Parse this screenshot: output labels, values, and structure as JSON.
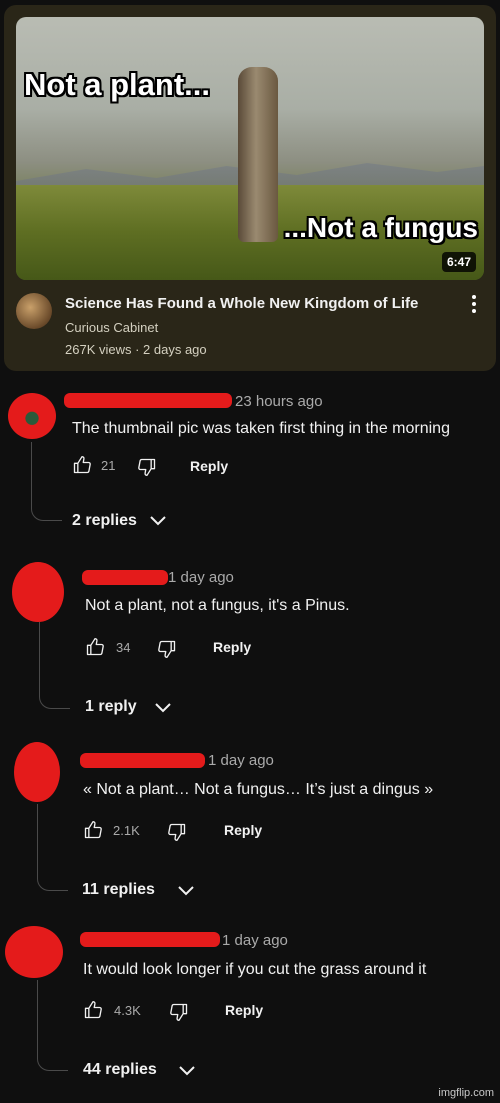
{
  "video": {
    "thumb_text_top": "Not a plant...",
    "thumb_text_bottom": "...Not a fungus",
    "duration": "6:47",
    "title": "Science Has Found a Whole New Kingdom of Life",
    "channel": "Curious Cabinet",
    "meta": "267K views · 2 days ago"
  },
  "comments": [
    {
      "time": "23 hours ago",
      "text": "The thumbnail  pic was taken first thing in the morning",
      "likes": "21",
      "reply": "Reply",
      "replies": "2 replies"
    },
    {
      "time": "1 day ago",
      "text": "Not a plant, not a fungus, it's a Pinus.",
      "likes": "34",
      "reply": "Reply",
      "replies": "1 reply"
    },
    {
      "time": "1 day ago",
      "text": "« Not a plant… Not a fungus… It’s just a dingus »",
      "likes": "2.1K",
      "reply": "Reply",
      "replies": "11 replies"
    },
    {
      "time": "1 day ago",
      "text": "It would look longer if you cut the grass around it",
      "likes": "4.3K",
      "reply": "Reply",
      "replies": "44 replies"
    }
  ],
  "watermark": "imgflip.com",
  "colors": {
    "background": "#0f0f0f",
    "card": "#2a2618",
    "redaction": "#e41b1b"
  }
}
